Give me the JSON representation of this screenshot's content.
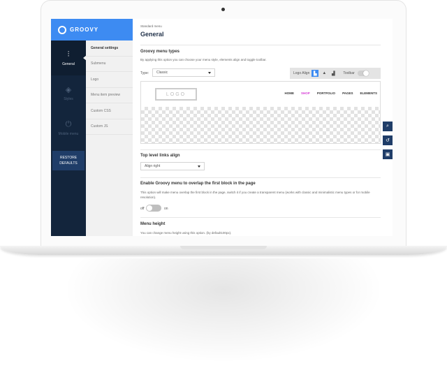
{
  "brand": {
    "name": "GROOVY"
  },
  "nav": {
    "items": [
      {
        "label": "General",
        "icon": "sliders-icon",
        "glyph": "⫶",
        "active": true
      },
      {
        "label": "Styles",
        "icon": "layers-icon",
        "glyph": "◈",
        "active": false
      },
      {
        "label": "Mobile menu",
        "icon": "power-icon",
        "glyph": "⏻",
        "active": false
      }
    ],
    "restore_label": "RESTORE DEFAULTS"
  },
  "subnav": {
    "items": [
      "General settings",
      "Submenu",
      "Logo",
      "Menu item preview",
      "Custom CSS",
      "Custom JS"
    ]
  },
  "header": {
    "breadcrumb": "Standard menu",
    "title": "General"
  },
  "menu_types": {
    "heading": "Groovy menu types",
    "description": "By applying this option you can choose your menu style, elements align and toggle toolbar.",
    "type_label": "Type:",
    "type_value": "Classic",
    "logo_align_label": "Logo Align",
    "toolbar_label": "Toolbar"
  },
  "preview": {
    "logo_text": "LOGO",
    "menu_items": [
      "HOME",
      "SHOP",
      "PORTFOLIO",
      "PAGES",
      "ELEMENTS"
    ],
    "active_item": "SHOP"
  },
  "links_align": {
    "heading": "Top level links align",
    "value": "Align right"
  },
  "overlap": {
    "heading": "Enable Groovy menu to overlap the first block in the page",
    "description": "This option will make menu overlap the first block in the page, switch it if you create a transparent menu (works with classic and minimalistic menu types or for mobile resolution).",
    "off_label": "off",
    "on_label": "on"
  },
  "menu_height": {
    "heading": "Menu height",
    "description": "You can change menu height using this option. (by default100px)."
  },
  "colors": {
    "accent": "#3d8bf2",
    "sidebar": "#13253c",
    "active_menu": "#d63cd6"
  }
}
